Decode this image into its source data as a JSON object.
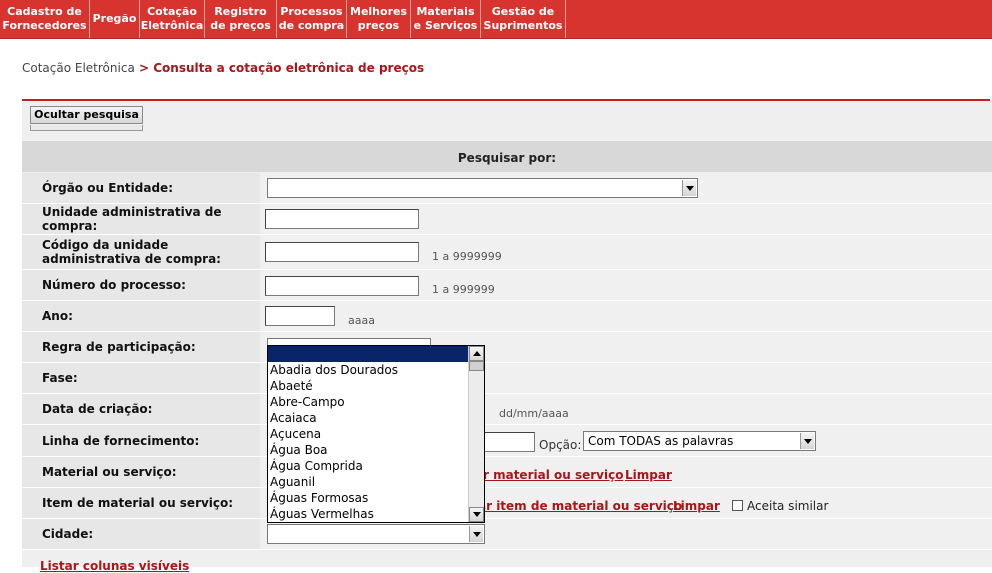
{
  "nav": {
    "items": [
      "Cadastro de\nFornecedores",
      "Pregão",
      "Cotação\nEletrônica",
      "Registro\nde preços",
      "Processos\nde compra",
      "Melhores\npreços",
      "Materiais\ne Serviços",
      "Gestão de\nSuprimentos"
    ]
  },
  "breadcrumb": {
    "root": "Cotação Eletrônica",
    "sep": " > ",
    "current": "Consulta a cotação eletrônica de preços"
  },
  "hide_button": "Ocultar pesquisa",
  "search_heading": "Pesquisar por:",
  "fields": {
    "orgao": "Órgão ou Entidade:",
    "unidade": "Unidade administrativa de compra:",
    "codigo": "Código da unidade administrativa de compra:",
    "codigo_hint": "1 a 9999999",
    "numero": "Número do processo:",
    "numero_hint": "1 a 999999",
    "ano": "Ano:",
    "ano_hint": "aaaa",
    "regra": "Regra de participação:",
    "fase": "Fase:",
    "data": "Data de criação:",
    "data_hint": "dd/mm/aaaa",
    "linha": "Linha de fornecimento:",
    "opcao_label": "Opção:",
    "opcao_value": "Com TODAS as palavras",
    "material": "Material ou serviço:",
    "material_link": "r material ou serviço",
    "limpar1": "Limpar",
    "item": "Item de material ou serviço:",
    "item_link": "ar item de material ou serviço",
    "limpar2": "Limpar",
    "aceita": "Aceita similar",
    "cidade": "Cidade:"
  },
  "city_dropdown": {
    "options": [
      "",
      "Abadia dos Dourados",
      "Abaeté",
      "Abre-Campo",
      "Acaiaca",
      "Açucena",
      "Água Boa",
      "Água Comprida",
      "Aguanil",
      "Águas Formosas",
      "Águas Vermelhas"
    ],
    "selected_index": 0
  },
  "bottom_link": "Listar colunas visíveis",
  "colors": {
    "nav_bg": "#d8342f",
    "accent": "#a8151a",
    "selection": "#0a246a"
  }
}
